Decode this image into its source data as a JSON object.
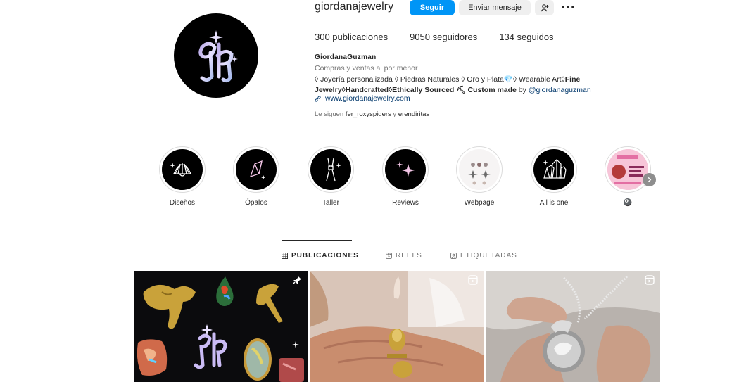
{
  "profile": {
    "username": "giordanajewelry",
    "follow_label": "Seguir",
    "message_label": "Enviar mensaje",
    "posts_count": "300 publicaciones",
    "followers_count": "9050 seguidores",
    "following_count": "134 seguidos",
    "full_name": "GiordanaGuzman",
    "category": "Compras y ventas al por menor",
    "bio_line1": "◊ Joyería personalizada ◊ Piedras Naturales ◊ Oro y Plata💎◊ Wearable Art◊",
    "bio_line1_bold": "Fine",
    "bio_line2_bold": "Jewelry◊Handcrafted◊Ethically Sourced ⛏ Custom made",
    "bio_by": " by ",
    "bio_mention": "@giordanaguzman",
    "website": "www.giordanajewelry.com",
    "followed_prefix": "Le siguen ",
    "followed_user1": "fer_roxyspiders",
    "followed_sep": " y ",
    "followed_user2": "erendiritas"
  },
  "highlights": [
    {
      "label": "Diseños",
      "icon": "shell-icon"
    },
    {
      "label": "Ópalos",
      "icon": "crystal-icon"
    },
    {
      "label": "Taller",
      "icon": "pliers-icon"
    },
    {
      "label": "Reviews",
      "icon": "sparkles-icon"
    },
    {
      "label": "Webpage",
      "icon": "webpage-icon"
    },
    {
      "label": "All is one",
      "icon": "crystals-cluster-icon"
    },
    {
      "label": "🎱",
      "icon": "event-flyer-icon"
    }
  ],
  "tabs": {
    "posts": "PUBLICACIONES",
    "reels": "REELS",
    "tagged": "ETIQUETADAS"
  },
  "colors": {
    "accent": "#0095f6",
    "text": "#262626",
    "secondary": "#737373",
    "link": "#00376b"
  }
}
